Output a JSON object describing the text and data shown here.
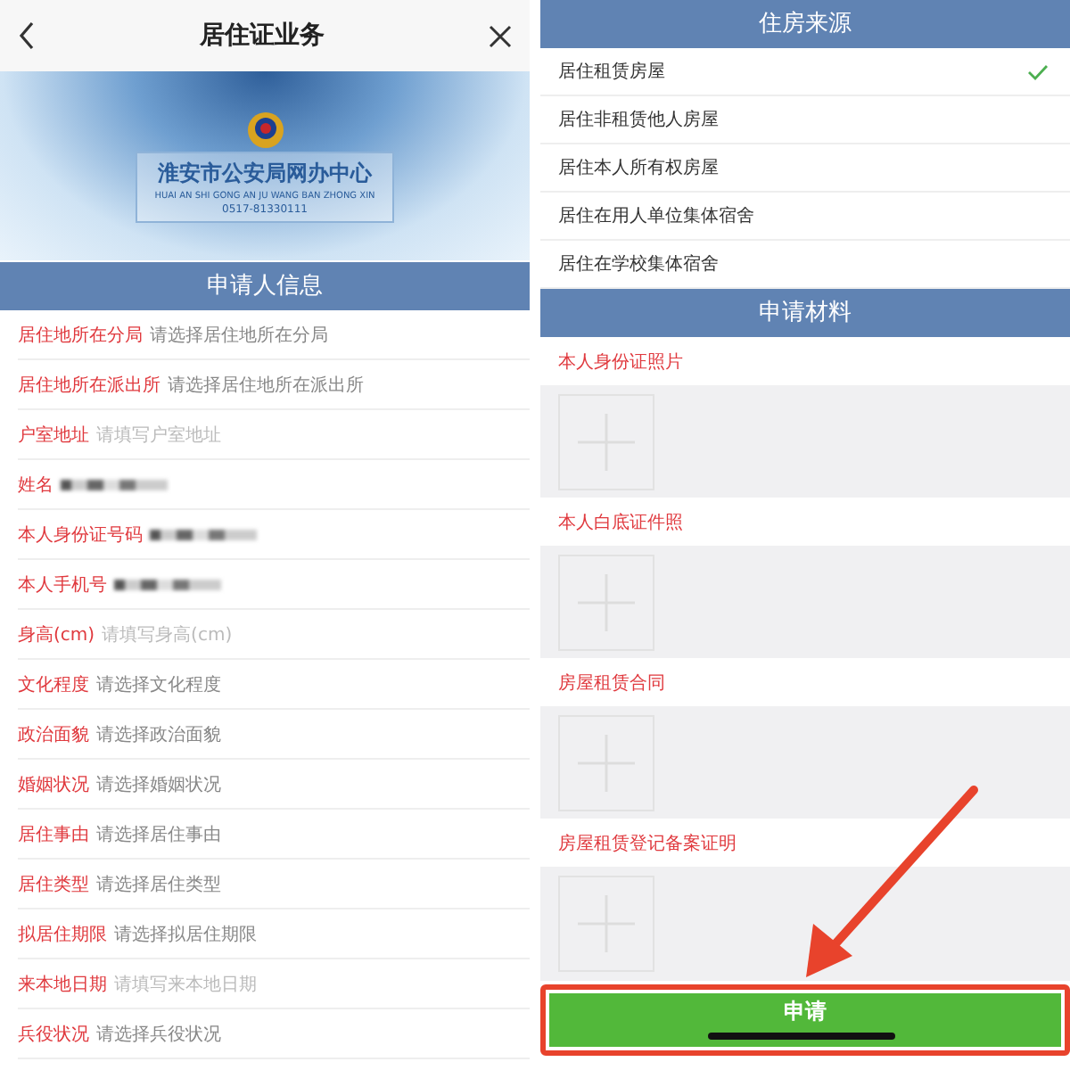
{
  "left": {
    "nav": {
      "title": "居住证业务"
    },
    "banner": {
      "title": "淮安市公安局网办中心",
      "subtitle": "HUAI AN SHI GONG AN JU WANG BAN ZHONG XIN",
      "phone": "0517-81330111"
    },
    "section_title": "申请人信息",
    "fields": [
      {
        "label": "居住地所在分局",
        "kind": "select",
        "placeholder": "请选择居住地所在分局"
      },
      {
        "label": "居住地所在派出所",
        "kind": "select",
        "placeholder": "请选择居住地所在派出所"
      },
      {
        "label": "户室地址",
        "kind": "input",
        "placeholder": "请填写户室地址"
      },
      {
        "label": "姓名",
        "kind": "blurred"
      },
      {
        "label": "本人身份证号码",
        "kind": "blurred"
      },
      {
        "label": "本人手机号",
        "kind": "blurred"
      },
      {
        "label": "身高(cm)",
        "kind": "input",
        "placeholder": "请填写身高(cm)"
      },
      {
        "label": "文化程度",
        "kind": "select",
        "placeholder": "请选择文化程度"
      },
      {
        "label": "政治面貌",
        "kind": "select",
        "placeholder": "请选择政治面貌"
      },
      {
        "label": "婚姻状况",
        "kind": "select",
        "placeholder": "请选择婚姻状况"
      },
      {
        "label": "居住事由",
        "kind": "select",
        "placeholder": "请选择居住事由"
      },
      {
        "label": "居住类型",
        "kind": "select",
        "placeholder": "请选择居住类型"
      },
      {
        "label": "拟居住期限",
        "kind": "select",
        "placeholder": "请选择拟居住期限"
      },
      {
        "label": "来本地日期",
        "kind": "input",
        "placeholder": "请填写来本地日期"
      },
      {
        "label": "兵役状况",
        "kind": "select",
        "placeholder": "请选择兵役状况"
      }
    ]
  },
  "right": {
    "housing_title": "住房来源",
    "housing_options": [
      {
        "label": "居住租赁房屋",
        "selected": true
      },
      {
        "label": "居住非租赁他人房屋",
        "selected": false
      },
      {
        "label": "居住本人所有权房屋",
        "selected": false
      },
      {
        "label": "居住在用人单位集体宿舍",
        "selected": false
      },
      {
        "label": "居住在学校集体宿舍",
        "selected": false
      }
    ],
    "materials_title": "申请材料",
    "materials": [
      {
        "label": "本人身份证照片"
      },
      {
        "label": "本人白底证件照"
      },
      {
        "label": "房屋租赁合同"
      },
      {
        "label": "房屋租赁登记备案证明"
      }
    ],
    "submit_button": "申请"
  }
}
